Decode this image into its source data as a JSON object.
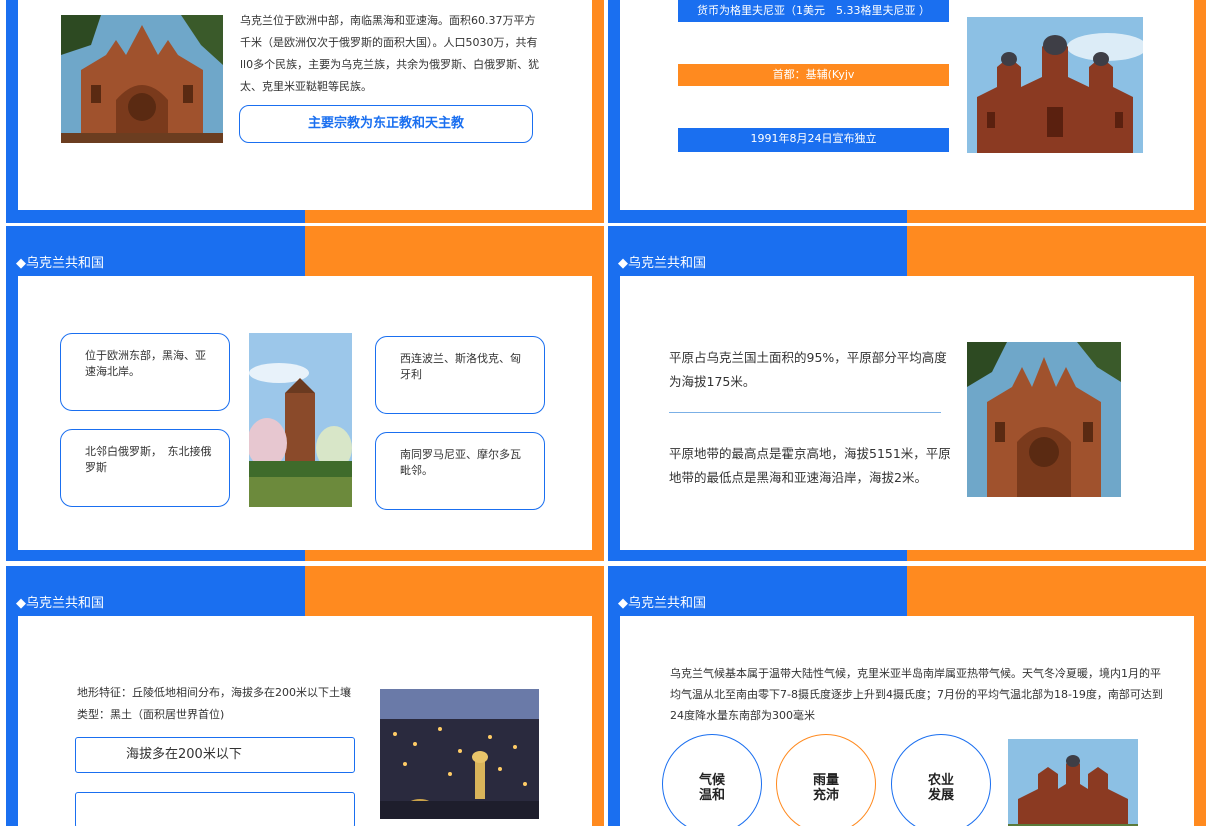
{
  "colors": {
    "blue": "#1a6ff0",
    "orange": "#ff8a1f"
  },
  "slide1": {
    "description": "乌克兰位于欧洲中部，南临黑海和亚速海。面积60.37万平方千米（是欧洲仅次于俄罗斯的面积大国）。人口5030万，共有ll0多个民族，主要为乌克兰族，共余为俄罗斯、白俄罗斯、犹太、克里米亚鞑靼等民族。",
    "religion_button": "主要宗教为东正教和天主教"
  },
  "slide2": {
    "bars": [
      {
        "text": "货币为格里夫尼亚（1美元　5.33格里夫尼亚 ）",
        "color": "blue"
      },
      {
        "text": "首都：基辅(Kyjv",
        "color": "orange"
      },
      {
        "text": "1991年8月24日宣布独立",
        "color": "blue"
      }
    ]
  },
  "slide3": {
    "title": "◆乌克兰共和国",
    "boxes": [
      {
        "text": "位于欧洲东部，黑海、亚速海北岸。"
      },
      {
        "text": "北邻白俄罗斯，　东北接俄罗斯"
      },
      {
        "text": "西连波兰、斯洛伐克、匈牙利"
      },
      {
        "text": "南同罗马尼亚、摩尔多瓦毗邻。"
      }
    ]
  },
  "slide4": {
    "title": "◆乌克兰共和国",
    "para1": "平原占乌克兰国土面积的95%，平原部分平均高度为海拔175米。",
    "para2": "平原地带的最高点是霍京高地，海拔5151米，平原地带的最低点是黑海和亚速海沿岸，海拔2米。"
  },
  "slide5": {
    "title": "◆乌克兰共和国",
    "terrain": "地形特征：丘陵低地相间分布，海拔多在200米以下土壤类型：黑土（面积居世界首位)",
    "box1": "海拔多在200米以下"
  },
  "slide6": {
    "title": "◆乌克兰共和国",
    "climate": "乌克兰气候基本属于温带大陆性气候，克里米亚半岛南岸属亚热带气候。天气冬冷夏暖，境内1月的平均气温从北至南由零下7-8摄氏度逐步上升到4摄氏度；7月份的平均气温北部为18-19度，南部可达到24度降水量东南部为300毫米",
    "circles": [
      {
        "line1": "气候",
        "line2": "温和",
        "color": "blue"
      },
      {
        "line1": "雨量",
        "line2": "充沛",
        "color": "orange"
      },
      {
        "line1": "农业",
        "line2": "发展",
        "color": "blue"
      }
    ]
  }
}
